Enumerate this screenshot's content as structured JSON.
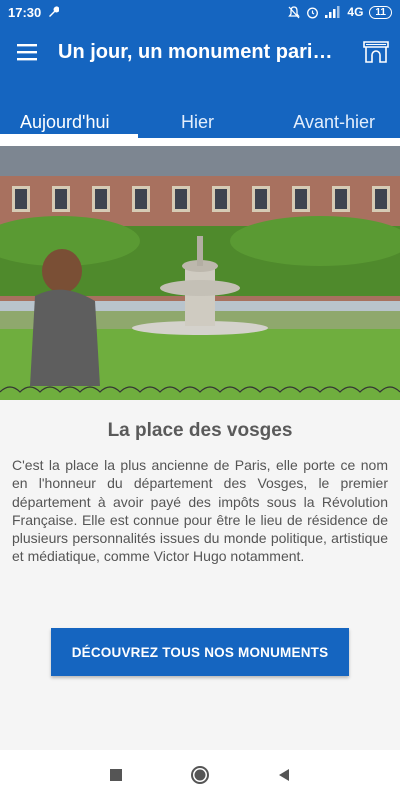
{
  "status": {
    "time": "17:30",
    "network": "4G",
    "battery": "11"
  },
  "appbar": {
    "title": "Un jour, un monument paris…"
  },
  "tabs": [
    {
      "label": "Aujourd'hui",
      "active": true
    },
    {
      "label": "Hier",
      "active": false
    },
    {
      "label": "Avant-hier",
      "active": false
    }
  ],
  "monument": {
    "name": "La place des vosges",
    "description": "C'est la place la plus ancienne de Paris, elle porte ce nom en l'honneur du département des Vosges, le premier département à avoir payé des impôts sous la Révolution Française. Elle est connue pour être le lieu de résidence de plusieurs personnalités issues du monde politique, artistique et médiatique, comme Victor Hugo notamment."
  },
  "cta": {
    "label": "DÉCOUVREZ TOUS NOS MONUMENTS"
  },
  "colors": {
    "primary": "#1565c0",
    "text": "#555555"
  },
  "icons": [
    "wrench-icon",
    "bell-off-icon",
    "alarm-icon",
    "signal-icon",
    "menu-icon",
    "arch-icon",
    "stop-icon",
    "home-icon",
    "back-icon"
  ]
}
